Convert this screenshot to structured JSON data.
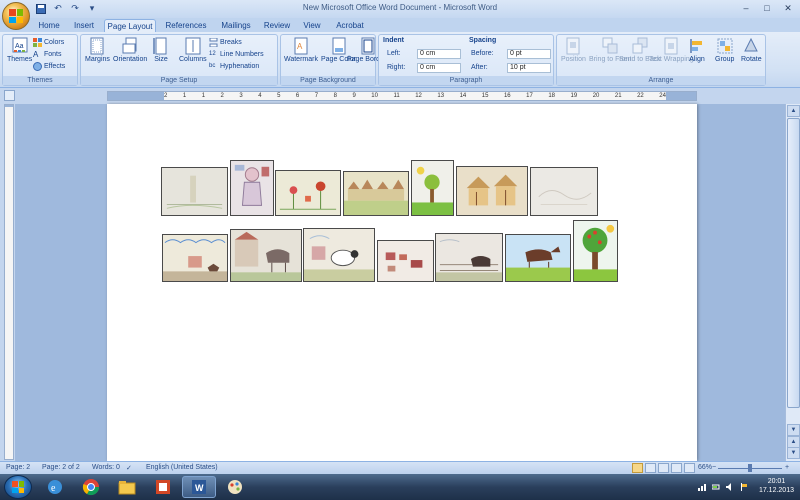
{
  "window": {
    "title": "New Microsoft Office Word Document - Microsoft Word",
    "controls": [
      "minimize",
      "maximize",
      "close"
    ]
  },
  "tabs": [
    "Home",
    "Insert",
    "Page Layout",
    "References",
    "Mailings",
    "Review",
    "View",
    "Acrobat"
  ],
  "active_tab": "Page Layout",
  "ribbon": {
    "themes": {
      "label": "Themes",
      "big": "Themes",
      "colors": "Colors",
      "fonts": "Fonts",
      "effects": "Effects"
    },
    "page_setup": {
      "label": "Page Setup",
      "margins": "Margins",
      "orientation": "Orientation",
      "size": "Size",
      "columns": "Columns",
      "breaks": "Breaks",
      "line_numbers": "Line Numbers",
      "hyphenation": "Hyphenation"
    },
    "page_background": {
      "label": "Page Background",
      "watermark": "Watermark",
      "page_color": "Page Color",
      "page_borders": "Page Borders"
    },
    "paragraph": {
      "label": "Paragraph",
      "indent_title": "Indent",
      "left_label": "Left:",
      "left_value": "0 cm",
      "right_label": "Right:",
      "right_value": "0 cm",
      "spacing_title": "Spacing",
      "before_label": "Before:",
      "before_value": "0 pt",
      "after_label": "After:",
      "after_value": "10 pt"
    },
    "arrange": {
      "label": "Arrange",
      "position": "Position",
      "bring_to_front": "Bring to Front",
      "send_to_back": "Send to Back",
      "text_wrapping": "Text Wrapping",
      "align": "Align",
      "group": "Group",
      "rotate": "Rotate"
    }
  },
  "ruler": {
    "ticks": [
      "2",
      "1",
      "1",
      "2",
      "3",
      "4",
      "5",
      "6",
      "7",
      "8",
      "9",
      "10",
      "11",
      "12",
      "13",
      "14",
      "15",
      "16",
      "17",
      "18",
      "19",
      "20",
      "21",
      "22",
      "24"
    ]
  },
  "document": {
    "row1_pictures": [
      "lighthouse-drawing",
      "person-drawing",
      "flowers-drawing",
      "village-drawing",
      "tree-drawing",
      "house-drawing",
      "faint-drawing"
    ],
    "row2_pictures": [
      "landscape-drawing",
      "castle-horse-drawing",
      "sheep-drawing",
      "red-shapes-drawing",
      "fence-horse-drawing",
      "brown-horse-drawing",
      "apple-tree-drawing"
    ]
  },
  "statusbar": {
    "page": "Page: 2",
    "pages": "Page: 2 of 2",
    "words": "Words: 0",
    "language": "English (United States)",
    "zoom": "66%"
  },
  "taskbar": {
    "clock_time": "20:01",
    "clock_date": "17.12.2013",
    "apps": [
      "internet-explorer",
      "chrome",
      "file-explorer",
      "powerpoint",
      "word",
      "paint"
    ]
  },
  "colors": {
    "ribbon_text": "#15428b",
    "doc_background": "#9fb9dd",
    "page": "#ffffff",
    "taskbar": "#2a3f5c"
  }
}
